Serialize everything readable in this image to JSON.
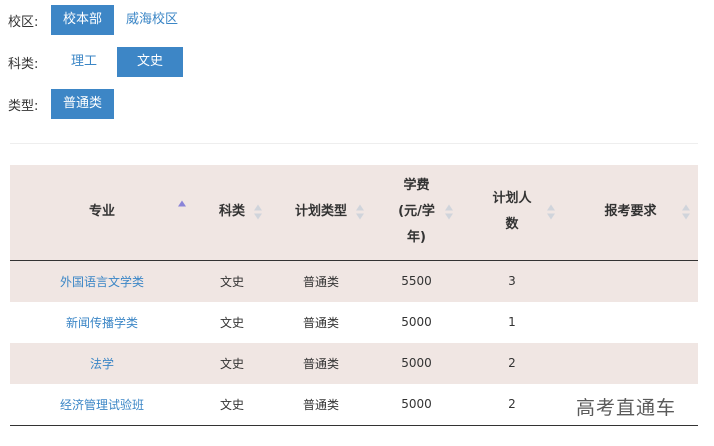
{
  "filters": {
    "campus": {
      "label": "校区:",
      "options": [
        "校本部",
        "威海校区"
      ],
      "selected": "校本部"
    },
    "subject": {
      "label": "科类:",
      "options": [
        "理工",
        "文史"
      ],
      "selected": "文史"
    },
    "type": {
      "label": "类型:",
      "options": [
        "普通类"
      ],
      "selected": "普通类"
    }
  },
  "table": {
    "headers": {
      "major": "专业",
      "subject": "科类",
      "plan_type": "计划类型",
      "fee_line1": "学费",
      "fee_line2": "(元/学",
      "fee_line3": "年)",
      "plan_count_line1": "计划人",
      "plan_count_line2": "数",
      "requirement": "报考要求"
    },
    "rows": [
      {
        "major": "外国语言文学类",
        "subject": "文史",
        "plan_type": "普通类",
        "fee": "5500",
        "plan_count": "3",
        "requirement": ""
      },
      {
        "major": "新闻传播学类",
        "subject": "文史",
        "plan_type": "普通类",
        "fee": "5000",
        "plan_count": "1",
        "requirement": ""
      },
      {
        "major": "法学",
        "subject": "文史",
        "plan_type": "普通类",
        "fee": "5000",
        "plan_count": "2",
        "requirement": ""
      },
      {
        "major": "经济管理试验班",
        "subject": "文史",
        "plan_type": "普通类",
        "fee": "5000",
        "plan_count": "2",
        "requirement": ""
      }
    ]
  },
  "watermark": "高考直通车",
  "colors": {
    "accent": "#3d86c6",
    "header_bg": "#f0e6e3",
    "sort_active": "#8a84d8"
  }
}
